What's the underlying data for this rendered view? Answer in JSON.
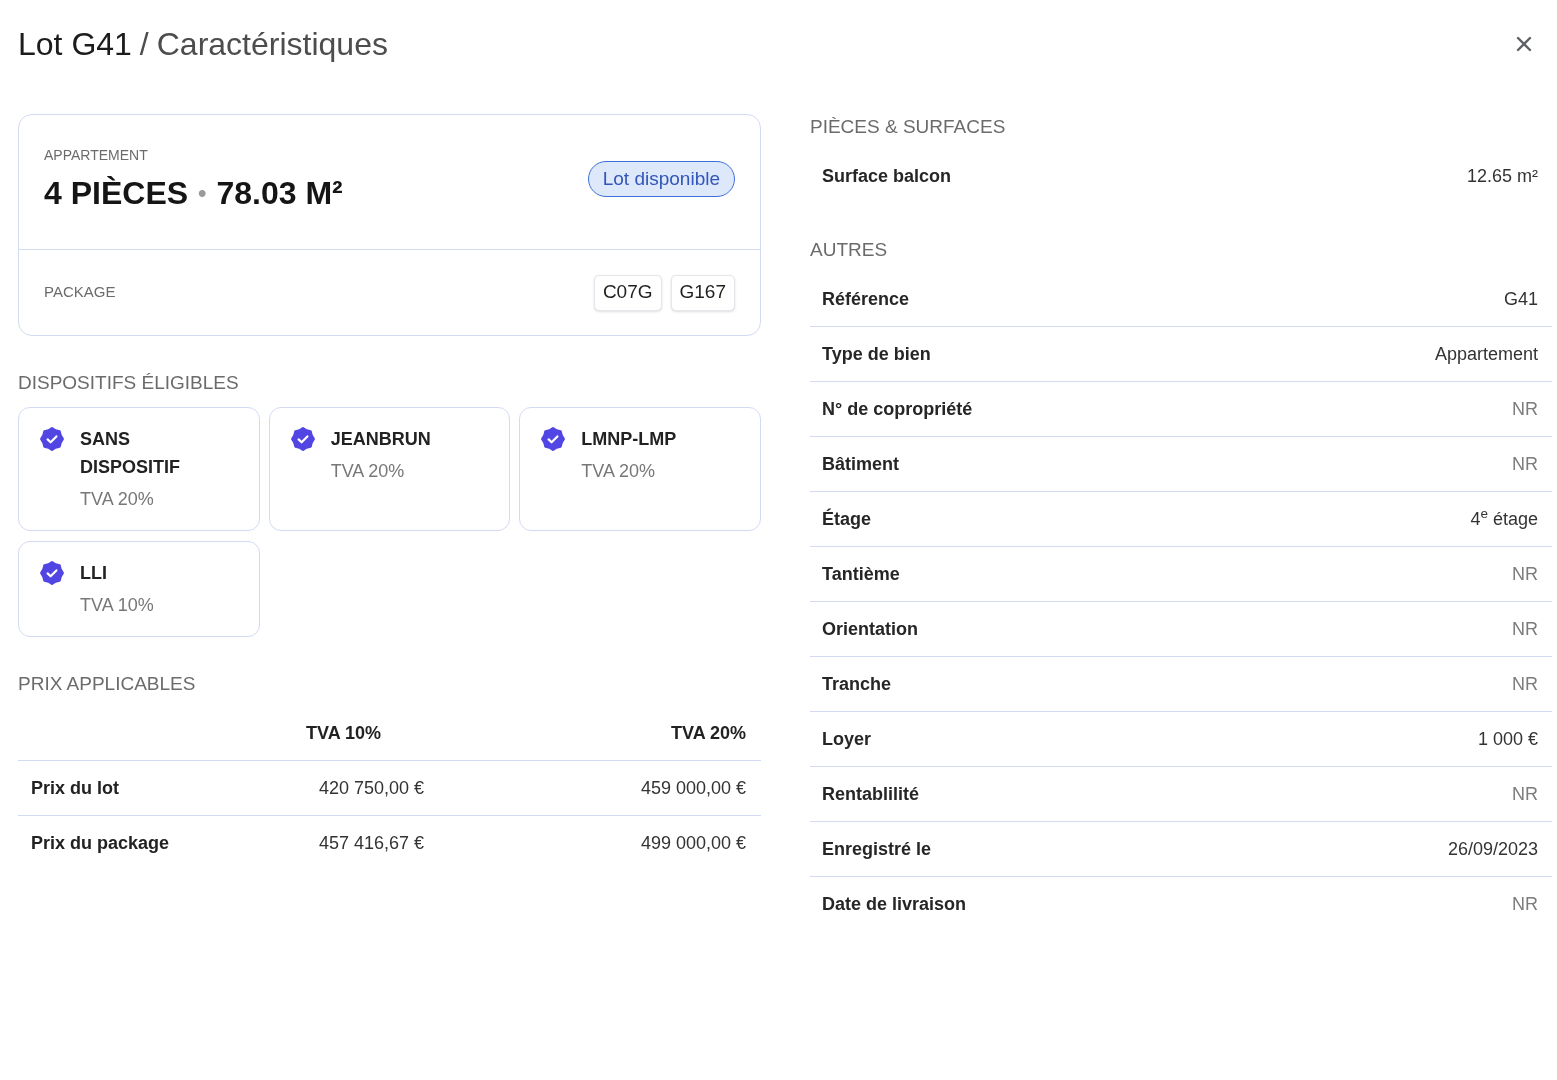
{
  "title": {
    "lot": "Lot G41",
    "separator": "/",
    "page": "Caractéristiques"
  },
  "lot_card": {
    "type": "APPARTEMENT",
    "headline": {
      "rooms": "4 PIÈCES",
      "separator": "•",
      "area": "78.03 M²"
    },
    "status": {
      "label": "Lot disponible",
      "kind": "available"
    },
    "package": {
      "label": "PACKAGE",
      "codes": [
        "C07G",
        "G167"
      ]
    }
  },
  "dispositifs": {
    "title": "DISPOSITIFS ÉLIGIBLES",
    "items": [
      {
        "name": "SANS DISPOSITIF",
        "vat": "TVA 20%",
        "eligible": true
      },
      {
        "name": "JEANBRUN",
        "vat": "TVA 20%",
        "eligible": true
      },
      {
        "name": "LMNP-LMP",
        "vat": "TVA 20%",
        "eligible": true
      },
      {
        "name": "LLI",
        "vat": "TVA 10%",
        "eligible": true
      }
    ]
  },
  "prices": {
    "title": "PRIX APPLICABLES",
    "columns": [
      "TVA 10%",
      "TVA 20%"
    ],
    "rows": [
      {
        "label": "Prix du lot",
        "values": [
          "420 750,00 €",
          "459 000,00 €"
        ]
      },
      {
        "label": "Prix du package",
        "values": [
          "457 416,67 €",
          "499 000,00 €"
        ]
      }
    ]
  },
  "sections": [
    {
      "title": "PIÈCES & SURFACES",
      "rows": [
        {
          "label": "Surface balcon",
          "value": "12.65 m²",
          "not_provided": false
        }
      ]
    },
    {
      "title": "AUTRES",
      "rows": [
        {
          "label": "Référence",
          "value": "G41",
          "not_provided": false
        },
        {
          "label": "Type de bien",
          "value": "Appartement",
          "not_provided": false
        },
        {
          "label": "N° de copropriété",
          "value": "NR",
          "not_provided": true
        },
        {
          "label": "Bâtiment",
          "value": "NR",
          "not_provided": true
        },
        {
          "label": "Étage",
          "value": "4$^{e}$ étage",
          "not_provided": false
        },
        {
          "label": "Tantième",
          "value": "NR",
          "not_provided": true
        },
        {
          "label": "Orientation",
          "value": "NR",
          "not_provided": true
        },
        {
          "label": "Tranche",
          "value": "NR",
          "not_provided": true
        },
        {
          "label": "Loyer",
          "value": "1 000 €",
          "not_provided": false
        },
        {
          "label": "Rentablilité",
          "value": "NR",
          "not_provided": true
        },
        {
          "label": "Enregistré le",
          "value": "26/09/2023",
          "not_provided": false
        },
        {
          "label": "Date de livraison",
          "value": "NR",
          "not_provided": true
        }
      ]
    }
  ]
}
